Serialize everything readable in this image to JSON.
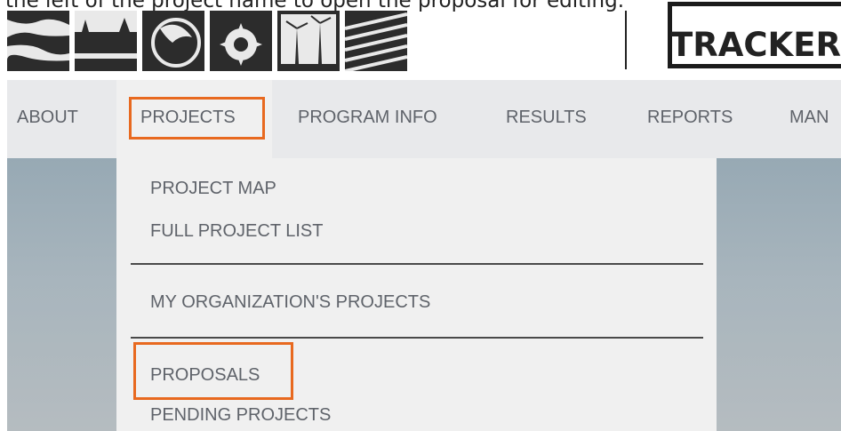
{
  "caption": {
    "text": "the left of the project name to open the proposal for editing."
  },
  "header": {
    "logo_word": "TRACKER"
  },
  "nav": {
    "items": [
      {
        "label": "ABOUT"
      },
      {
        "label": "PROJECTS"
      },
      {
        "label": "PROGRAM INFO"
      },
      {
        "label": "RESULTS"
      },
      {
        "label": "REPORTS"
      },
      {
        "label": "MAN"
      }
    ]
  },
  "dropdown": {
    "items": [
      {
        "label": "PROJECT MAP"
      },
      {
        "label": "FULL PROJECT LIST"
      },
      {
        "label": "MY ORGANIZATION'S PROJECTS"
      },
      {
        "label": "PROPOSALS"
      },
      {
        "label": "PENDING PROJECTS"
      }
    ]
  },
  "colors": {
    "highlight": "#e8691f",
    "nav_bg": "#e8e9eb",
    "dropdown_bg": "#f0f0f0",
    "text": "#5f636a"
  }
}
